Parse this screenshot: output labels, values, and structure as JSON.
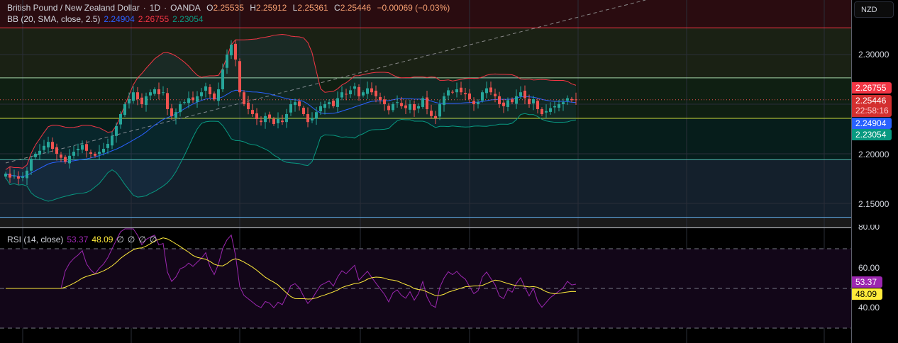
{
  "header": {
    "symbol": "British Pound / New Zealand Dollar",
    "interval": "1D",
    "exchange": "OANDA",
    "open_label": "O",
    "open": "2.25535",
    "high_label": "H",
    "high": "2.25912",
    "low_label": "L",
    "low": "2.25361",
    "close_label": "C",
    "close": "2.25446",
    "change": "−0.00069 (−0.03%)"
  },
  "bb": {
    "label": "BB (20, SMA, close, 2.5)",
    "basis": "2.24904",
    "upper": "2.26755",
    "lower": "2.23054"
  },
  "rsi": {
    "label": "RSI (14, close)",
    "value": "53.37",
    "ma": "48.09",
    "extra": [
      "∅",
      "∅",
      "∅",
      "∅"
    ]
  },
  "axis": {
    "currency": "NZD",
    "price_ticks": [
      "2.30000",
      "2.20000",
      "2.15000"
    ],
    "rsi_ticks": [
      "80.00",
      "60.00",
      "40.00"
    ],
    "tags": {
      "upper": "2.26755",
      "last": "2.25446",
      "countdown": "22:58:16",
      "basis": "2.24904",
      "lower": "2.23054",
      "rsi": "53.37",
      "rsi_ma": "48.09"
    }
  },
  "colors": {
    "up": "#26a69a",
    "down": "#ef5350",
    "bb_basis": "#2962ff",
    "bb_upper": "#f23645",
    "bb_lower": "#089981",
    "rsi": "#9c27b0",
    "rsi_ma": "#ffeb3b"
  },
  "chart_data": {
    "type": "candlestick",
    "price_range": [
      2.12,
      2.35
    ],
    "closes": [
      2.18,
      2.176,
      2.178,
      2.175,
      2.177,
      2.183,
      2.195,
      2.2,
      2.203,
      2.208,
      2.212,
      2.205,
      2.2,
      2.196,
      2.192,
      2.198,
      2.202,
      2.205,
      2.209,
      2.203,
      2.2,
      2.198,
      2.202,
      2.205,
      2.21,
      2.218,
      2.228,
      2.24,
      2.25,
      2.255,
      2.262,
      2.255,
      2.25,
      2.258,
      2.262,
      2.265,
      2.26,
      2.262,
      2.245,
      2.238,
      2.242,
      2.25,
      2.252,
      2.256,
      2.254,
      2.258,
      2.262,
      2.268,
      2.26,
      2.255,
      2.265,
      2.285,
      2.3,
      2.31,
      2.295,
      2.262,
      2.25,
      2.245,
      2.24,
      2.235,
      2.232,
      2.238,
      2.236,
      2.23,
      2.235,
      2.232,
      2.24,
      2.25,
      2.252,
      2.248,
      2.24,
      2.232,
      2.236,
      2.242,
      2.248,
      2.25,
      2.252,
      2.248,
      2.256,
      2.262,
      2.26,
      2.264,
      2.268,
      2.258,
      2.262,
      2.266,
      2.262,
      2.258,
      2.254,
      2.25,
      2.244,
      2.25,
      2.252,
      2.248,
      2.246,
      2.25,
      2.244,
      2.248,
      2.256,
      2.245,
      2.238,
      2.236,
      2.25,
      2.258,
      2.264,
      2.262,
      2.265,
      2.262,
      2.26,
      2.255,
      2.25,
      2.252,
      2.262,
      2.266,
      2.262,
      2.258,
      2.25,
      2.248,
      2.254,
      2.252,
      2.258,
      2.262,
      2.256,
      2.25,
      2.255,
      2.245,
      2.24,
      2.243,
      2.246,
      2.248,
      2.25,
      2.252,
      2.256,
      2.254,
      2.25446
    ],
    "hlines": [
      2.327,
      2.2765,
      2.2357,
      2.194,
      2.136
    ],
    "rsi_levels": [
      70,
      50,
      30
    ],
    "rsi_range": [
      25,
      80
    ]
  }
}
